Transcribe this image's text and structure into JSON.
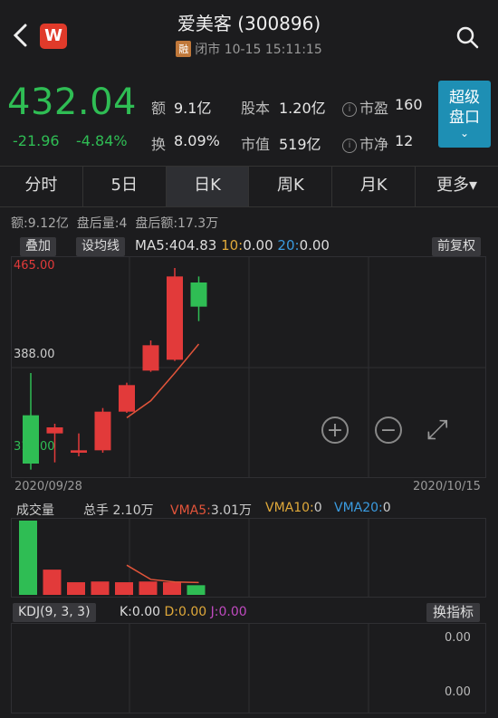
{
  "header": {
    "logo_text": "W",
    "title": "爱美客 (300896)",
    "rong_badge": "融",
    "status": "闭市 10-15 15:11:15",
    "icons": [
      "back-icon",
      "search-icon"
    ]
  },
  "quote": {
    "price": "432.04",
    "change": "-21.96",
    "change_pct": "-4.84%",
    "amount_label": "额",
    "amount": "9.1亿",
    "turnover_label": "换",
    "turnover": "8.09%",
    "shares_label": "股本",
    "shares": "1.20亿",
    "mktcap_label": "市值",
    "mktcap": "519亿",
    "pe_label": "市盈",
    "pe": "160",
    "pb_label": "市净",
    "pb": "12",
    "info_icon_glyph": "i",
    "super_btn_line1": "超级",
    "super_btn_line2": "盘口",
    "super_btn_arrow": "⌄",
    "color_down": "#2fbd54",
    "color_up": "#e23a3a"
  },
  "tabs": [
    {
      "label": "分时"
    },
    {
      "label": "5日"
    },
    {
      "label": "日K"
    },
    {
      "label": "周K"
    },
    {
      "label": "月K"
    },
    {
      "label": "更多▾"
    }
  ],
  "stats": "额:9.12亿  盘后量:4  盘后额:17.3万",
  "kchart": {
    "overlay_btn": "叠加",
    "ma_set_btn": "设均线",
    "ma5_label": "MA5:",
    "ma5": "404.83",
    "ma10_label": "10:",
    "ma10": "0.00",
    "ma20_label": "20:",
    "ma20": "0.00",
    "adjust_btn": "前复权",
    "y_high": "465.00",
    "y_mid": "388.00",
    "y_low": "311.00",
    "date_start": "2020/09/28",
    "date_end": "2020/10/15",
    "zoom_in": "+",
    "zoom_out": "−",
    "expand_glyph": "⤢"
  },
  "volume": {
    "label": "成交量",
    "total_label": "总手",
    "total": "2.10万",
    "vma5_label": "VMA5:",
    "vma5": "3.01万",
    "vma10_label": "VMA10:",
    "vma10": "0",
    "vma20_label": "VMA20:",
    "vma20": "0"
  },
  "kdj": {
    "label": "KDJ(9, 3, 3)",
    "k_label": "K:",
    "k": "0.00",
    "d_label": "D:",
    "d": "0.00",
    "j_label": "J:",
    "j": "0.00",
    "switch_btn": "换指标",
    "val_top": "0.00",
    "val_bottom": "0.00"
  },
  "chart_data": {
    "type": "candlestick",
    "ylim": [
      300,
      465
    ],
    "candles": [
      {
        "open": 340,
        "close": 300,
        "high": 375,
        "low": 295
      },
      {
        "open": 325,
        "close": 330,
        "high": 333,
        "low": 301
      },
      {
        "open": 309,
        "close": 311,
        "high": 325,
        "low": 306
      },
      {
        "open": 311,
        "close": 343,
        "high": 346,
        "low": 309
      },
      {
        "open": 343,
        "close": 365,
        "high": 367,
        "low": 342
      },
      {
        "open": 377,
        "close": 398,
        "high": 402,
        "low": 376
      },
      {
        "open": 386,
        "close": 455,
        "high": 462,
        "low": 385
      },
      {
        "open": 450,
        "close": 430,
        "high": 455,
        "low": 418
      }
    ],
    "ma5": [
      null,
      null,
      null,
      null,
      338,
      352,
      375,
      399
    ],
    "volume": [
      100,
      34,
      17,
      18,
      17,
      18,
      17,
      13
    ],
    "vma5": [
      null,
      null,
      null,
      null,
      40,
      20.8,
      17.4,
      16.6
    ]
  }
}
